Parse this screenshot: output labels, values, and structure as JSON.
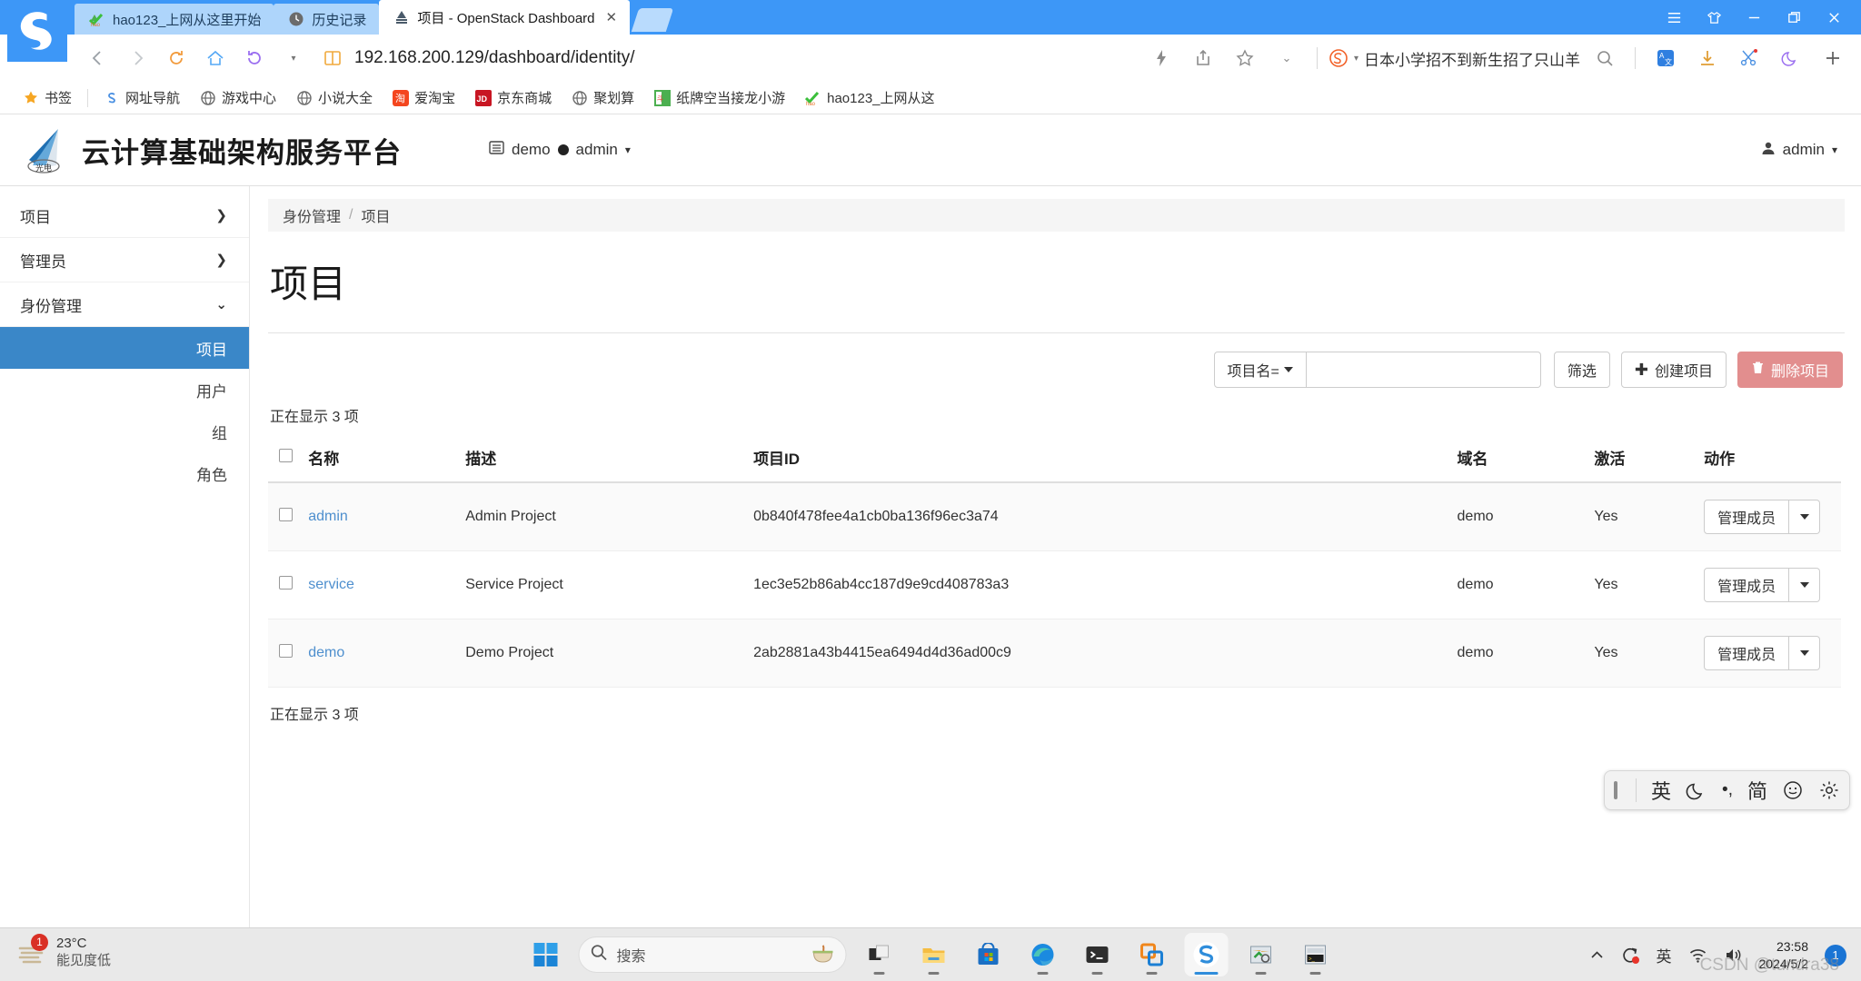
{
  "browser": {
    "tabs": [
      {
        "title": "hao123_上网从这里开始",
        "icon": "hao123-favicon",
        "active": false
      },
      {
        "title": "历史记录",
        "icon": "history-clock-icon",
        "active": false
      },
      {
        "title": "项目 - OpenStack Dashboard",
        "icon": "openstack-favicon",
        "active": true
      }
    ],
    "tab_close_label": "✕",
    "url": "192.168.200.129/dashboard/identity/",
    "search_keyword": "日本小学招不到新生招了只山羊",
    "window_controls": {
      "menu": "hamburger-menu-icon",
      "skin": "skin-shirt-icon",
      "minimize": "minimize-icon",
      "restore": "restore-icon",
      "close": "close-icon"
    },
    "bookmarks": [
      {
        "label": "书签",
        "icon": "star-icon"
      },
      {
        "label": "网址导航",
        "icon": "sogou-nav-icon"
      },
      {
        "label": "游戏中心",
        "icon": "globe-icon"
      },
      {
        "label": "小说大全",
        "icon": "globe-icon"
      },
      {
        "label": "爱淘宝",
        "icon": "taobao-icon"
      },
      {
        "label": "京东商城",
        "icon": "jd-icon"
      },
      {
        "label": "聚划算",
        "icon": "globe-icon"
      },
      {
        "label": "纸牌空当接龙小游",
        "icon": "cards-icon"
      },
      {
        "label": "hao123_上网从这",
        "icon": "hao123-favicon"
      }
    ]
  },
  "dashboard": {
    "brand_title": "云计算基础架构服务平台",
    "brand_logo": "guangdian-logo",
    "context": {
      "project": "demo",
      "user": "admin",
      "project_icon": "project-card-icon",
      "dot_icon": "domain-dot-icon",
      "caret": "▾"
    },
    "user_menu": {
      "label": "admin",
      "icon": "user-icon",
      "caret": "▾"
    },
    "sidebar": {
      "groups": [
        {
          "label": "项目",
          "expanded": false,
          "chevron": "chevron-right-icon"
        },
        {
          "label": "管理员",
          "expanded": false,
          "chevron": "chevron-right-icon"
        },
        {
          "label": "身份管理",
          "expanded": true,
          "chevron": "chevron-down-icon"
        }
      ],
      "sub_items": [
        {
          "label": "项目",
          "active": true
        },
        {
          "label": "用户",
          "active": false
        },
        {
          "label": "组",
          "active": false
        },
        {
          "label": "角色",
          "active": false
        }
      ]
    },
    "breadcrumb": {
      "parent": "身份管理",
      "separator": "/",
      "current": "项目"
    },
    "page_title": "项目",
    "toolbar": {
      "filter_field_label": "项目名=",
      "filter_input_value": "",
      "filter_input_placeholder": "",
      "filter_button": "筛选",
      "create_button": "创建项目",
      "create_icon": "plus-icon",
      "delete_button": "删除项目",
      "delete_icon": "trash-icon",
      "delete_color": "#e28e8e"
    },
    "count_top": "正在显示 3 项",
    "count_bottom": "正在显示 3 项",
    "table": {
      "headers": [
        "名称",
        "描述",
        "项目ID",
        "域名",
        "激活",
        "动作"
      ],
      "rows": [
        {
          "name": "admin",
          "description": "Admin Project",
          "id": "0b840f478fee4a1cb0ba136f96ec3a74",
          "domain": "demo",
          "enabled": "Yes",
          "action": "管理成员"
        },
        {
          "name": "service",
          "description": "Service Project",
          "id": "1ec3e52b86ab4cc187d9e9cd408783a3",
          "domain": "demo",
          "enabled": "Yes",
          "action": "管理成员"
        },
        {
          "name": "demo",
          "description": "Demo Project",
          "id": "2ab2881a43b4415ea6494d4d36ad00c9",
          "domain": "demo",
          "enabled": "Yes",
          "action": "管理成员"
        }
      ]
    },
    "accent_color": "#3a87c8",
    "link_color": "#4e8fce"
  },
  "ime_bar": {
    "items": [
      {
        "label": "英",
        "name": "ime-language-english"
      },
      {
        "label": "",
        "name": "ime-moon-icon"
      },
      {
        "label": "•,",
        "name": "ime-punctuation"
      },
      {
        "label": "简",
        "name": "ime-simplified-chinese"
      },
      {
        "label": "",
        "name": "ime-emoji-icon"
      },
      {
        "label": "",
        "name": "ime-settings-gear-icon"
      }
    ]
  },
  "taskbar": {
    "weather": {
      "temperature": "23°C",
      "condition": "能见度低",
      "badge": "1"
    },
    "search": {
      "placeholder": "搜索",
      "icon": "search-icon"
    },
    "start_icon": "windows-start-icon",
    "apps": [
      {
        "name": "task-view-icon"
      },
      {
        "name": "file-explorer-icon"
      },
      {
        "name": "microsoft-store-icon"
      },
      {
        "name": "microsoft-edge-icon"
      },
      {
        "name": "terminal-icon"
      },
      {
        "name": "vmware-workstation-icon"
      },
      {
        "name": "sogou-browser-icon"
      },
      {
        "name": "xftp-icon"
      },
      {
        "name": "xshell-icon"
      }
    ],
    "tray": {
      "chevron": "show-hidden-icons-chevron",
      "update_icon": "windows-update-icon",
      "ime_label": "英",
      "wifi_icon": "wifi-icon",
      "volume_icon": "volume-icon",
      "time": "23:58",
      "date": "2024/5/2",
      "notification_count": "1"
    },
    "watermark": "CSDN @tundra38"
  }
}
